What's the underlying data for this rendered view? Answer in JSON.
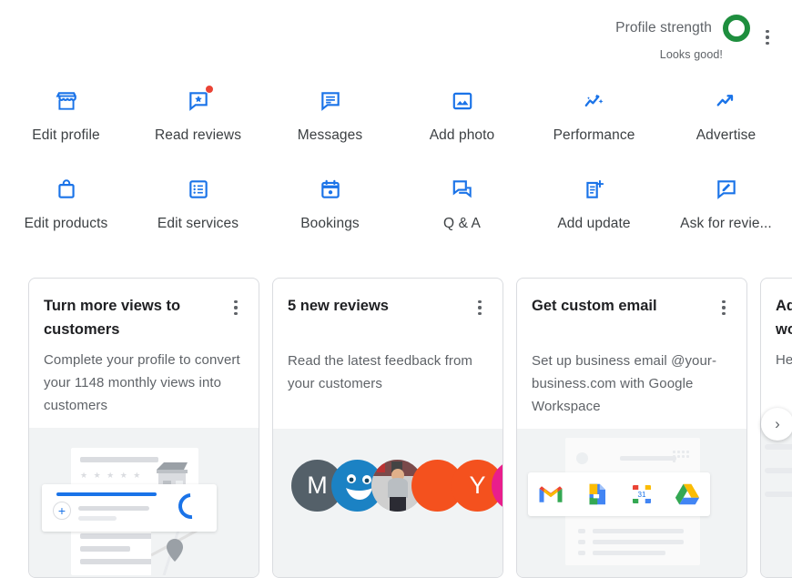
{
  "header": {
    "profile_strength_label": "Profile strength",
    "profile_strength_status": "Looks good!",
    "ring_color": "#1e8e3e",
    "menu_icon": "more-vert-icon"
  },
  "actions": [
    {
      "label": "Edit profile",
      "icon": "storefront-icon",
      "badge": false
    },
    {
      "label": "Read reviews",
      "icon": "review-star-icon",
      "badge": true
    },
    {
      "label": "Messages",
      "icon": "chat-lines-icon",
      "badge": false
    },
    {
      "label": "Add photo",
      "icon": "photo-icon",
      "badge": false
    },
    {
      "label": "Performance",
      "icon": "insights-icon",
      "badge": false
    },
    {
      "label": "Advertise",
      "icon": "trending-up-icon",
      "badge": false
    },
    {
      "label": "Edit products",
      "icon": "shopping-bag-icon",
      "badge": false
    },
    {
      "label": "Edit services",
      "icon": "list-box-icon",
      "badge": false
    },
    {
      "label": "Bookings",
      "icon": "calendar-icon",
      "badge": false
    },
    {
      "label": "Q & A",
      "icon": "forum-icon",
      "badge": false
    },
    {
      "label": "Add update",
      "icon": "post-add-icon",
      "badge": false
    },
    {
      "label": "Ask for revie...",
      "icon": "rate-review-icon",
      "badge": false
    }
  ],
  "cards": [
    {
      "title": "Turn more views to customers",
      "desc": "Complete your profile to convert your 1148 monthly views into customers",
      "illustration": "profile-completion-illustration"
    },
    {
      "title": "5 new reviews",
      "desc": "Read the latest feedback from your customers",
      "illustration": "reviewer-avatars-illustration"
    },
    {
      "title": "Get custom email",
      "desc": "Set up business email @your-business.com with Google Workspace",
      "illustration": "google-workspace-illustration"
    },
    {
      "title": "Ad wo",
      "desc": "He ne",
      "illustration": "partial-illustration"
    }
  ],
  "avatars": [
    {
      "initial": "M",
      "color": "#546069",
      "type": "initial"
    },
    {
      "initial": "",
      "color": "#1b82c4",
      "type": "smiley"
    },
    {
      "initial": "",
      "color": "#8d8d8d",
      "type": "photo"
    },
    {
      "initial": "",
      "color": "#f4511e",
      "type": "plain"
    },
    {
      "initial": "Y",
      "color": "#f4511e",
      "type": "initial"
    },
    {
      "initial": "e",
      "color": "#e91e8c",
      "type": "initial"
    }
  ],
  "workspace_apps": [
    "gmail-icon",
    "docs-icon",
    "calendar-31-icon",
    "drive-icon"
  ],
  "card_menu_icon": "more-vert-icon",
  "next_arrow": "chevron-right-icon",
  "colors": {
    "blue": "#1a73e8",
    "red": "#ea4335",
    "green": "#1e8e3e",
    "text_primary": "#202124",
    "text_secondary": "#5f6368",
    "card_border": "#dadce0",
    "image_bg": "#f1f3f4"
  }
}
